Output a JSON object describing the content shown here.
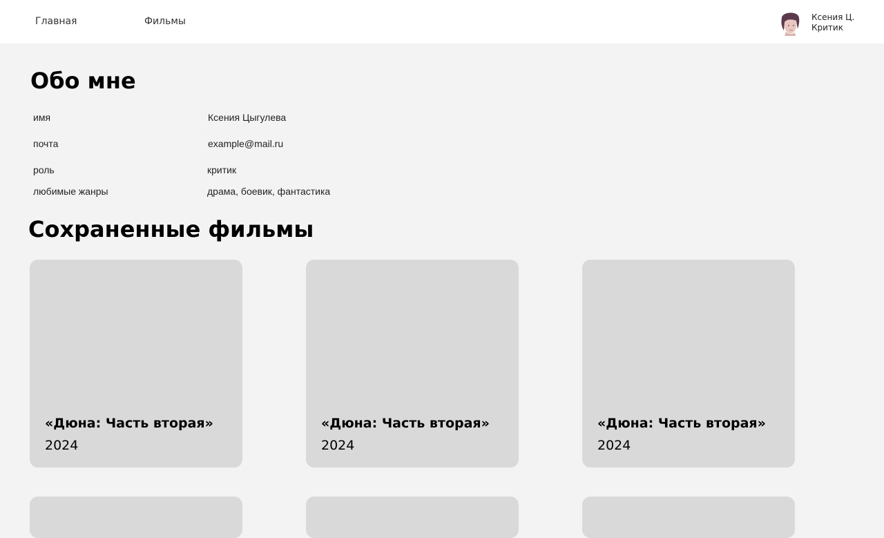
{
  "nav": {
    "home_label": "Главная",
    "films_label": "Фильмы"
  },
  "profile": {
    "short_name": "Ксения Ц.",
    "role": "Критик",
    "avatar_icon": "user-avatar-photo"
  },
  "about": {
    "title": "Обо мне",
    "rows": [
      {
        "label": "имя",
        "value": "Ксения Цыгулева"
      },
      {
        "label": "почта",
        "value": "example@mail.ru"
      },
      {
        "label": "роль",
        "value": "критик"
      },
      {
        "label": "любимые жанры",
        "value": "драма, боевик, фантастика"
      }
    ]
  },
  "saved": {
    "title": "Сохраненные фильмы",
    "films": [
      {
        "title": "«Дюна: Часть вторая»",
        "year": "2024"
      },
      {
        "title": "«Дюна: Часть вторая»",
        "year": "2024"
      },
      {
        "title": "«Дюна: Часть вторая»",
        "year": "2024"
      }
    ]
  },
  "colors": {
    "page_background": "#f3f3f3",
    "header_background": "#ffffff",
    "card_background": "#d9d9d9"
  }
}
